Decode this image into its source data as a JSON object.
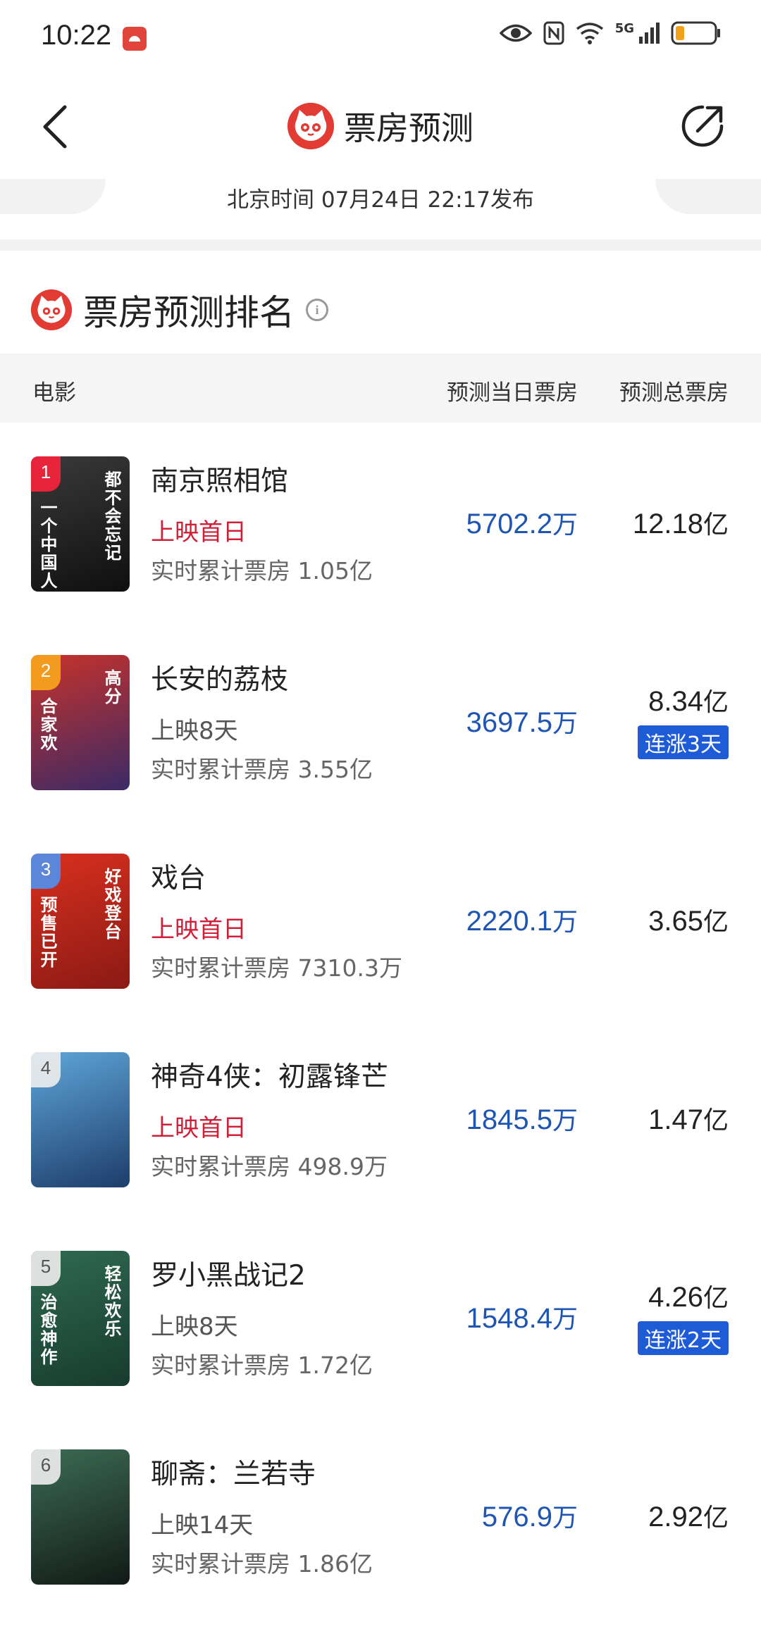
{
  "status_bar": {
    "time": "10:22",
    "network": "5G",
    "app_icon": "huawei-app-icon"
  },
  "nav": {
    "title": "票房预测",
    "back_icon": "back-arrow-icon",
    "share_icon": "share-icon",
    "logo_icon": "maoyan-cat-logo-icon"
  },
  "publish_time": "北京时间  07月24日  22:17发布",
  "section": {
    "title": "票房预测排名",
    "info_icon": "info-icon"
  },
  "table_header": {
    "movie": "电影",
    "day_forecast": "预测当日票房",
    "total_forecast": "预测总票房"
  },
  "movies": [
    {
      "rank": "1",
      "name": "南京照相馆",
      "status": "上映首日",
      "status_type": "first",
      "cumulative": "实时累计票房 1.05亿",
      "day_value": "5702.2",
      "day_unit": "万",
      "total_value": "12.18",
      "total_unit": "亿",
      "badge": "",
      "poster_text_a": "都不会忘记",
      "poster_text_b": "一个中国人",
      "poster_colors": [
        "#3a3a3a",
        "#0f0f0f"
      ]
    },
    {
      "rank": "2",
      "name": "长安的荔枝",
      "status": "上映8天",
      "status_type": "days",
      "cumulative": "实时累计票房 3.55亿",
      "day_value": "3697.5",
      "day_unit": "万",
      "total_value": "8.34",
      "total_unit": "亿",
      "badge": "连涨3天",
      "poster_text_a": "高分",
      "poster_text_b": "合家欢",
      "poster_colors": [
        "#c8322a",
        "#3b2a66"
      ]
    },
    {
      "rank": "3",
      "name": "戏台",
      "status": "上映首日",
      "status_type": "first",
      "cumulative": "实时累计票房 7310.3万",
      "day_value": "2220.1",
      "day_unit": "万",
      "total_value": "3.65",
      "total_unit": "亿",
      "badge": "",
      "poster_text_a": "好戏登台",
      "poster_text_b": "预售已开",
      "poster_colors": [
        "#d9301f",
        "#8a1a14"
      ]
    },
    {
      "rank": "4",
      "name": "神奇4侠：初露锋芒",
      "status": "上映首日",
      "status_type": "first",
      "cumulative": "实时累计票房 498.9万",
      "day_value": "1845.5",
      "day_unit": "万",
      "total_value": "1.47",
      "total_unit": "亿",
      "badge": "",
      "poster_text_a": "",
      "poster_text_b": "",
      "poster_colors": [
        "#5fa6d8",
        "#1d3d6b"
      ]
    },
    {
      "rank": "5",
      "name": "罗小黑战记2",
      "status": "上映8天",
      "status_type": "days",
      "cumulative": "实时累计票房 1.72亿",
      "day_value": "1548.4",
      "day_unit": "万",
      "total_value": "4.26",
      "total_unit": "亿",
      "badge": "连涨2天",
      "poster_text_a": "轻松欢乐",
      "poster_text_b": "治愈神作",
      "poster_colors": [
        "#2f6a52",
        "#183b2e"
      ]
    },
    {
      "rank": "6",
      "name": "聊斋：兰若寺",
      "status": "上映14天",
      "status_type": "days",
      "cumulative": "实时累计票房 1.86亿",
      "day_value": "576.9",
      "day_unit": "万",
      "total_value": "2.92",
      "total_unit": "亿",
      "badge": "",
      "poster_text_a": "",
      "poster_text_b": "",
      "poster_colors": [
        "#3d6b55",
        "#111a16"
      ]
    }
  ],
  "colors": {
    "accent_red": "#e13b34",
    "value_blue": "#1e55b3",
    "badge_blue": "#1e5bd6",
    "first_day_red": "#d11f38"
  }
}
